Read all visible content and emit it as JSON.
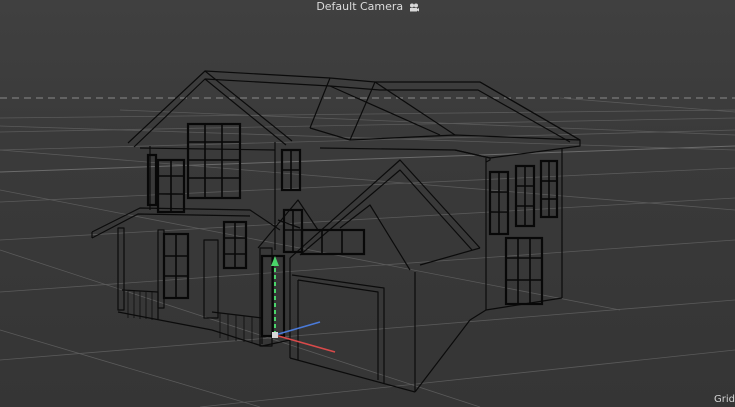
{
  "viewport": {
    "camera_label": "Default Camera",
    "camera_icon": "camera-icon",
    "grid_label": "Grid"
  },
  "colors": {
    "background": "#3a3a3a",
    "grid": "#5a5a5a",
    "wireframe": "#0b0b0b",
    "axis_x": "#d84a4a",
    "axis_y": "#4ad46a",
    "axis_z": "#4a7ad8"
  },
  "scene": {
    "object": "house-wireframe-model",
    "gizmo": "transform-gizmo"
  }
}
